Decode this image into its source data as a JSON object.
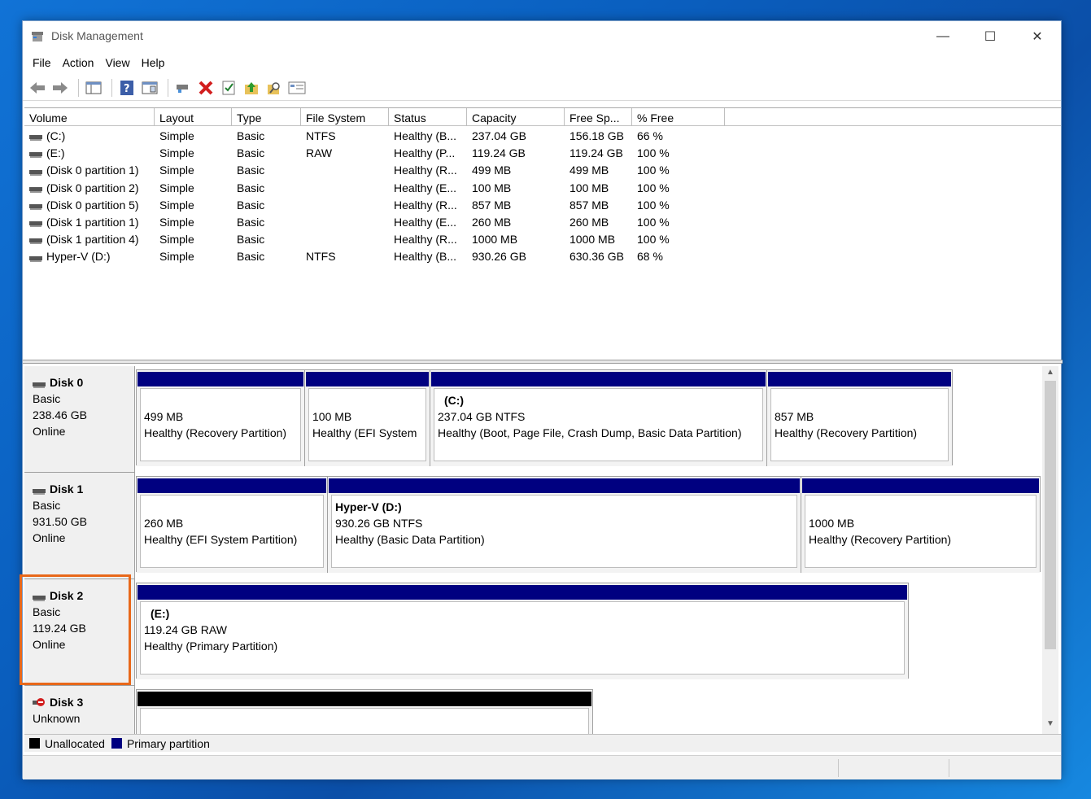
{
  "window": {
    "title": "Disk Management",
    "controls": {
      "minimize": "—",
      "maximize": "☐",
      "close": "✕"
    }
  },
  "menu": [
    "File",
    "Action",
    "View",
    "Help"
  ],
  "toolbar": {
    "icons": [
      "back-arrow-icon",
      "forward-arrow-icon",
      "console-tree-icon",
      "help-icon",
      "properties-icon",
      "connect-drive-icon",
      "delete-icon",
      "check-icon",
      "up-folder-icon",
      "search-icon",
      "settings-icon"
    ]
  },
  "volume_list": {
    "headers": [
      "Volume",
      "Layout",
      "Type",
      "File System",
      "Status",
      "Capacity",
      "Free Sp...",
      "% Free"
    ],
    "rows": [
      [
        "(C:)",
        "Simple",
        "Basic",
        "NTFS",
        "Healthy (B...",
        "237.04 GB",
        "156.18 GB",
        "66 %"
      ],
      [
        "(E:)",
        "Simple",
        "Basic",
        "RAW",
        "Healthy (P...",
        "119.24 GB",
        "119.24 GB",
        "100 %"
      ],
      [
        "(Disk 0 partition 1)",
        "Simple",
        "Basic",
        "",
        "Healthy (R...",
        "499 MB",
        "499 MB",
        "100 %"
      ],
      [
        "(Disk 0 partition 2)",
        "Simple",
        "Basic",
        "",
        "Healthy (E...",
        "100 MB",
        "100 MB",
        "100 %"
      ],
      [
        "(Disk 0 partition 5)",
        "Simple",
        "Basic",
        "",
        "Healthy (R...",
        "857 MB",
        "857 MB",
        "100 %"
      ],
      [
        "(Disk 1 partition 1)",
        "Simple",
        "Basic",
        "",
        "Healthy (E...",
        "260 MB",
        "260 MB",
        "100 %"
      ],
      [
        "(Disk 1 partition 4)",
        "Simple",
        "Basic",
        "",
        "Healthy (R...",
        "1000 MB",
        "1000 MB",
        "100 %"
      ],
      [
        "Hyper-V (D:)",
        "Simple",
        "Basic",
        "NTFS",
        "Healthy (B...",
        "930.26 GB",
        "630.36 GB",
        "68 %"
      ]
    ]
  },
  "disks": [
    {
      "name": "Disk 0",
      "type": "Basic",
      "size": "238.46 GB",
      "status": "Online",
      "partitions": [
        {
          "name": "",
          "line1": "499 MB",
          "line2": "Healthy (Recovery Partition)",
          "kind": "primary"
        },
        {
          "name": "",
          "line1": "100 MB",
          "line2": "Healthy (EFI System",
          "kind": "primary"
        },
        {
          "name": "(C:)",
          "line1": "237.04 GB NTFS",
          "line2": "Healthy (Boot, Page File, Crash Dump, Basic Data Partition)",
          "kind": "primary"
        },
        {
          "name": "",
          "line1": "857 MB",
          "line2": "Healthy (Recovery Partition)",
          "kind": "primary"
        }
      ]
    },
    {
      "name": "Disk 1",
      "type": "Basic",
      "size": "931.50 GB",
      "status": "Online",
      "partitions": [
        {
          "name": "",
          "line1": "260 MB",
          "line2": "Healthy (EFI System Partition)",
          "kind": "primary"
        },
        {
          "name": "Hyper-V  (D:)",
          "line1": "930.26 GB NTFS",
          "line2": "Healthy (Basic Data Partition)",
          "kind": "primary"
        },
        {
          "name": "",
          "line1": "1000 MB",
          "line2": "Healthy (Recovery Partition)",
          "kind": "primary"
        }
      ]
    },
    {
      "name": "Disk 2",
      "type": "Basic",
      "size": "119.24 GB",
      "status": "Online",
      "partitions": [
        {
          "name": "(E:)",
          "line1": "119.24 GB RAW",
          "line2": "Healthy (Primary Partition)",
          "kind": "primary"
        }
      ]
    },
    {
      "name": "Disk 3",
      "type": "Unknown",
      "partitions": [
        {
          "name": "",
          "line1": "",
          "line2": "",
          "kind": "unallocated"
        }
      ]
    }
  ],
  "legend": [
    {
      "label": "Unallocated",
      "color": "#000000"
    },
    {
      "label": "Primary partition",
      "color": "#000080"
    }
  ],
  "colors": {
    "primary": "#000080",
    "unallocated": "#000000",
    "highlight": "#e8681a"
  }
}
